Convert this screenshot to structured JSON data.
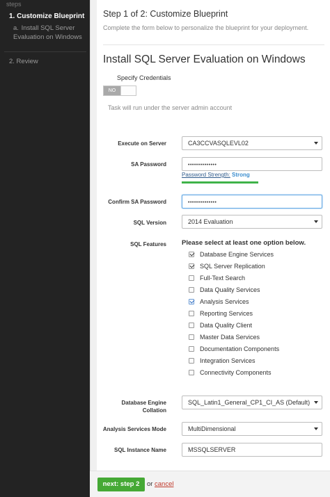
{
  "sidebar": {
    "steps_label": "steps",
    "step1": "1.  Customize Blueprint",
    "step1_sub_num": "a.",
    "step1_sub": "Install SQL Server Evaluation on Windows",
    "step2": "2.  Review"
  },
  "header": {
    "title": "Step 1 of 2: Customize Blueprint",
    "subtitle": "Complete the form below to personalize the blueprint for your deployment."
  },
  "blueprint": {
    "title": "Install SQL Server Evaluation on Windows",
    "credentials_label": "Specify Credentials",
    "toggle_off_label": "NO",
    "toggle_on": false,
    "task_note": "Task will run under the server admin account"
  },
  "form": {
    "execute_label": "Execute on Server",
    "execute_value": "CA3CCVASQLEVL02",
    "sa_password_label": "SA Password",
    "sa_password_value": "••••••••••••••",
    "strength_label": "Password Strength:",
    "strength_value": "Strong",
    "confirm_label": "Confirm SA Password",
    "confirm_value": "••••••••••••••",
    "version_label": "SQL Version",
    "version_value": "2014 Evaluation",
    "features_label": "SQL Features",
    "features_head": "Please select at least one option below.",
    "features": [
      {
        "label": "Database Engine Services",
        "checked": true
      },
      {
        "label": "SQL Server Replication",
        "checked": true
      },
      {
        "label": "Full-Text Search",
        "checked": false
      },
      {
        "label": "Data Quality Services",
        "checked": false
      },
      {
        "label": "Analysis Services",
        "checked": true
      },
      {
        "label": "Reporting Services",
        "checked": false
      },
      {
        "label": "Data Quality Client",
        "checked": false
      },
      {
        "label": "Master Data Services",
        "checked": false
      },
      {
        "label": "Documentation Components",
        "checked": false
      },
      {
        "label": "Integration Services",
        "checked": false
      },
      {
        "label": "Connectivity Components",
        "checked": false
      }
    ],
    "collation_label_1": "Database Engine",
    "collation_label_2": "Collation",
    "collation_value": "SQL_Latin1_General_CP1_CI_AS (Default)",
    "as_mode_label": "Analysis Services Mode",
    "as_mode_value": "MultiDimensional",
    "instance_label": "SQL Instance Name",
    "instance_value": "MSSQLSERVER"
  },
  "footer": {
    "next_label": "next: step 2",
    "or_text": "or",
    "cancel_label": "cancel"
  },
  "colors": {
    "sidebar_bg": "#232323",
    "next_button": "#45a935",
    "strength_bar": "#3fb349",
    "cancel_link": "#c0392b"
  }
}
